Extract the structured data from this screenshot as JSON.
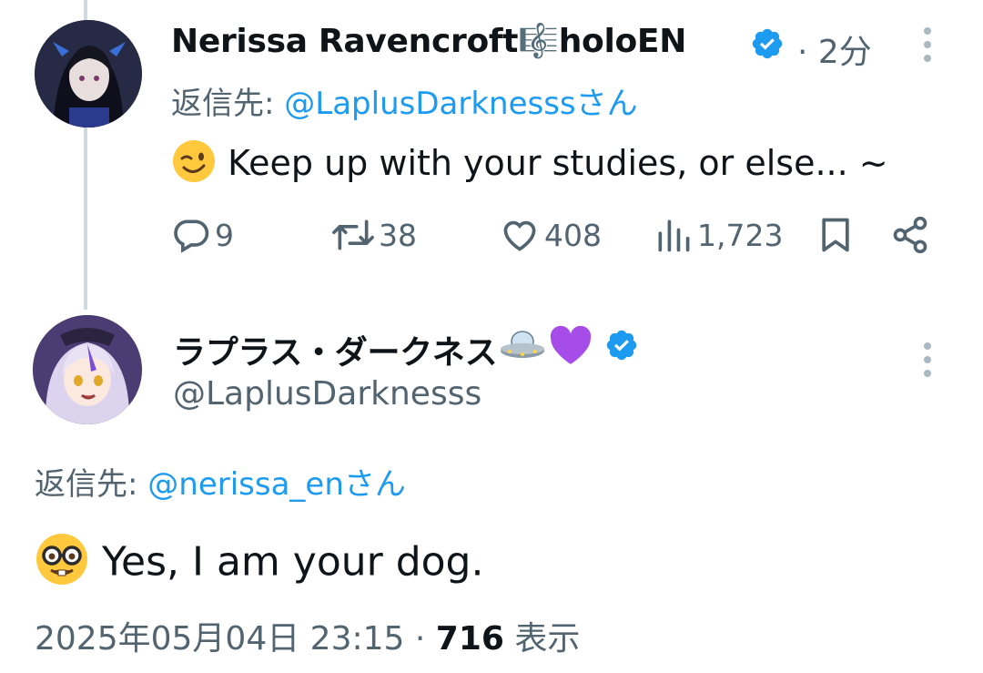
{
  "tweet1": {
    "display_name": "Nerissa Ravencroft",
    "name_emoji": "🎼",
    "name_suffix": "holoEN",
    "time": "· 2分",
    "reply_prefix": "返信先: ",
    "reply_handle": "@LaplusDarknesssさん",
    "text": "Keep up with your studies, or else... ~",
    "replies": "9",
    "retweets": "38",
    "likes": "408",
    "views": "1,723"
  },
  "tweet2": {
    "display_name": "ラプラス・ダークネス",
    "handle": "@LaplusDarknesss",
    "reply_prefix": "返信先: ",
    "reply_handle": "@nerissa_enさん",
    "text": "Yes, I am your dog.",
    "timestamp": "2025年05月04日 23:15 · ",
    "view_count": "716",
    "view_label": " 表示"
  },
  "colors": {
    "link": "#1d9bf0",
    "muted": "#536471",
    "verified": "#1d9bf0",
    "thread_line": "#cfd9de"
  },
  "icons": [
    "reply-icon",
    "retweet-icon",
    "like-icon",
    "views-icon",
    "bookmark-icon",
    "share-icon",
    "verified-badge-icon",
    "more-icon",
    "wink-emoji",
    "nerd-emoji",
    "ufo-emoji",
    "purple-heart-emoji"
  ]
}
